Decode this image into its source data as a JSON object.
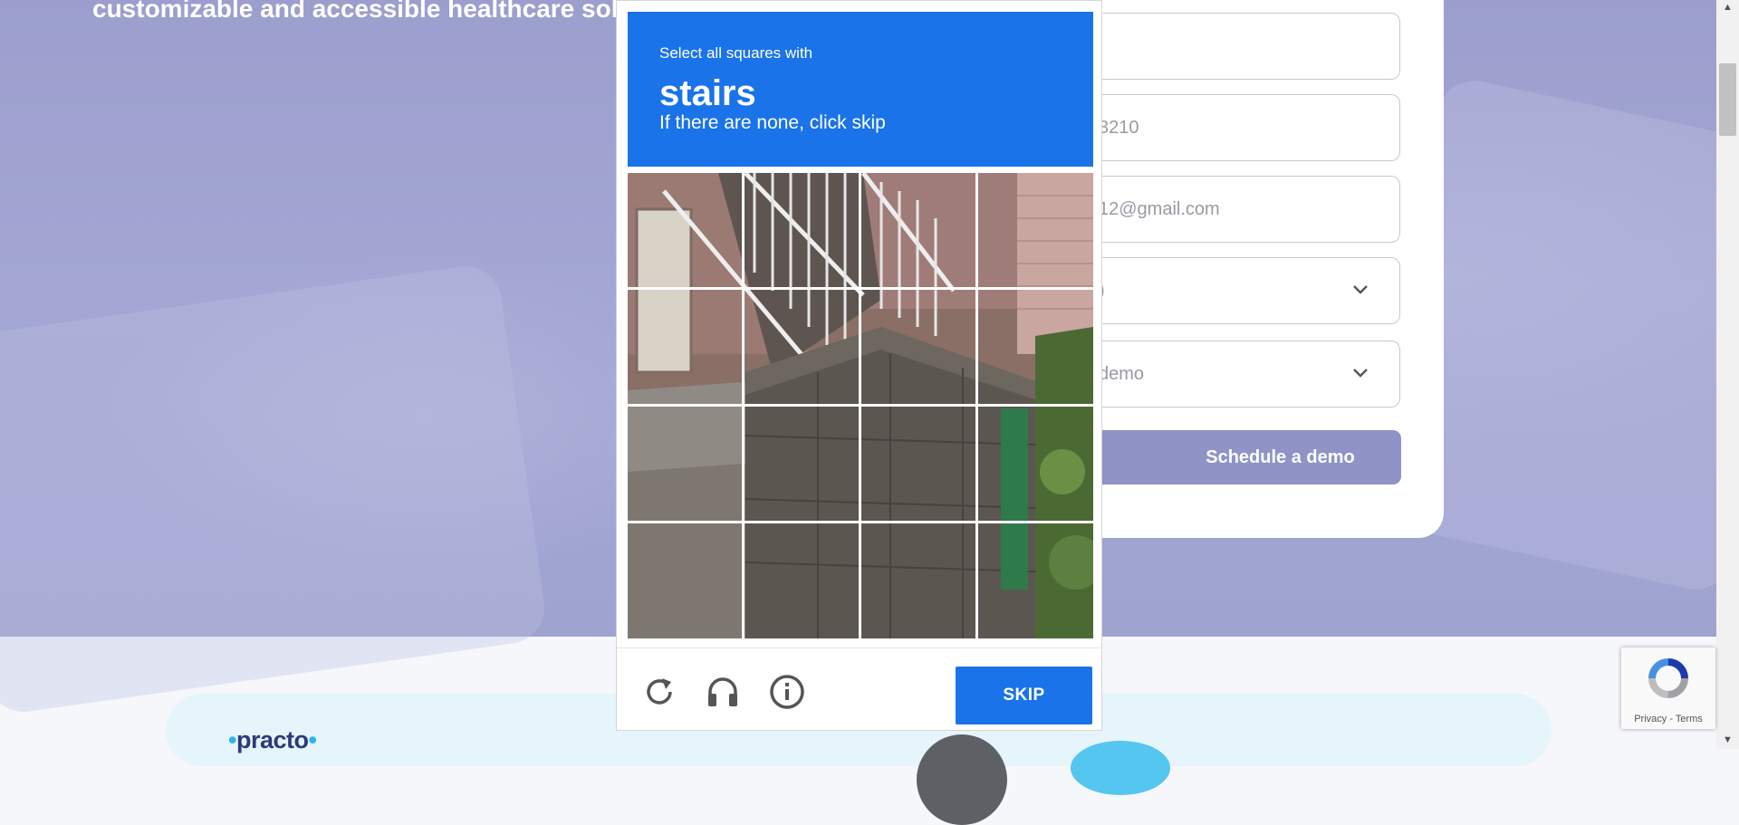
{
  "hero": {
    "text": "customizable and accessible healthcare solu"
  },
  "form": {
    "phone_value": "3210",
    "email_value": "12@gmail.com",
    "select1_value": ")",
    "select2_value": " demo",
    "submit_label": "Schedule a demo"
  },
  "captcha": {
    "instruction": "Select all squares with",
    "target_word": "stairs",
    "subtext": "If there are none, click skip",
    "skip_label": "SKIP",
    "reload_icon": "reload-icon",
    "audio_icon": "headphones-icon",
    "info_icon": "info-icon",
    "accent_color": "#1a73e8"
  },
  "recaptcha_badge": {
    "links": "Privacy - Terms"
  },
  "footer": {
    "logo_text": "practo"
  },
  "colors": {
    "hero_bg": "#a3a6d3",
    "demo_button": "#8f93c6"
  }
}
